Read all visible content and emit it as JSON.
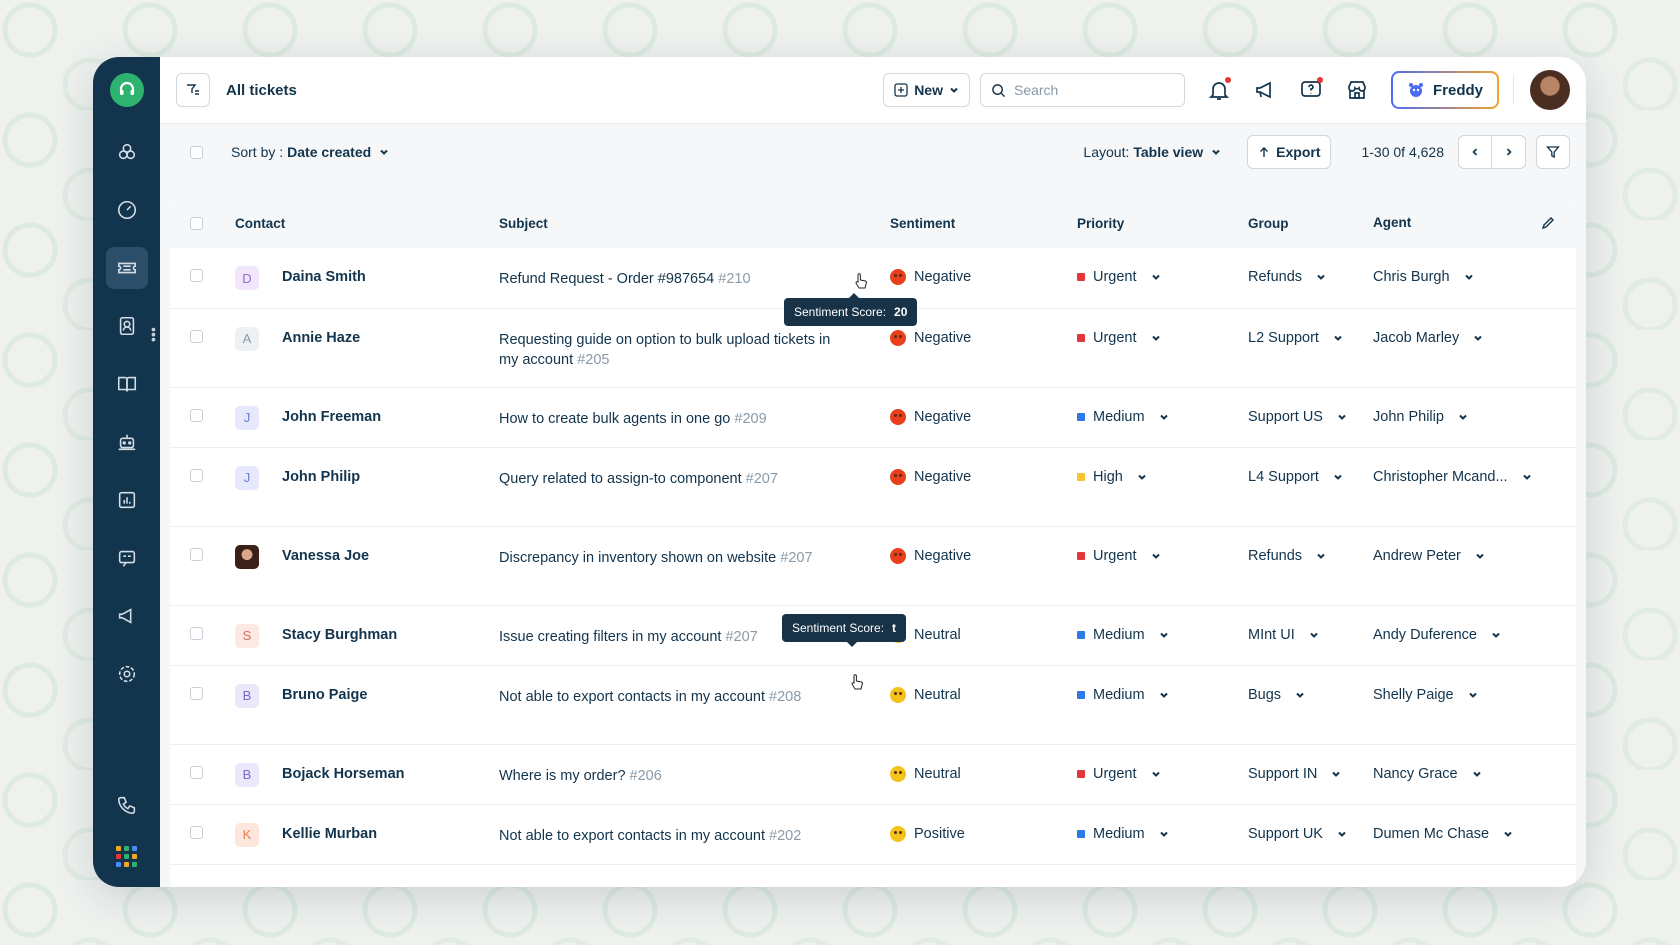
{
  "topbar": {
    "title": "All tickets",
    "new_label": "New",
    "search_placeholder": "Search",
    "freddy_label": "Freddy"
  },
  "toolbar": {
    "sort_prefix": "Sort by :",
    "sort_value": "Date created",
    "layout_prefix": "Layout:",
    "layout_value": "Table view",
    "export_label": "Export",
    "pager_text": "1-30 0f 4,628"
  },
  "table": {
    "headers": {
      "contact": "Contact",
      "subject": "Subject",
      "sentiment": "Sentiment",
      "priority": "Priority",
      "group": "Group",
      "agent": "Agent"
    },
    "rows": [
      {
        "initial": "D",
        "contact": "Daina Smith",
        "subject": "Refund Request - Order #987654",
        "id": "#210",
        "sentiment": "Negative",
        "priority": "Urgent",
        "group": "Refunds",
        "agent": "Chris Burgh"
      },
      {
        "initial": "A",
        "contact": "Annie Haze",
        "subject": "Requesting guide on option to bulk upload tickets in my account",
        "id": "#205",
        "sentiment": "Negative",
        "priority": "Urgent",
        "group": "L2 Support",
        "agent": "Jacob Marley"
      },
      {
        "initial": "J",
        "contact": "John Freeman",
        "subject": "How to create bulk agents in one go",
        "id": "#209",
        "sentiment": "Negative",
        "priority": "Medium",
        "group": "Support US",
        "agent": "John Philip"
      },
      {
        "initial": "J",
        "contact": "John Philip",
        "subject": "Query related to assign-to component",
        "id": "#207",
        "sentiment": "Negative",
        "priority": "High",
        "group": "L4 Support",
        "agent": "Christopher Mcand..."
      },
      {
        "initial": "",
        "contact": "Vanessa Joe",
        "subject": "Discrepancy in inventory shown on website",
        "id": "#207",
        "sentiment": "Negative",
        "priority": "Urgent",
        "group": "Refunds",
        "agent": "Andrew Peter"
      },
      {
        "initial": "S",
        "contact": "Stacy Burghman",
        "subject": "Issue creating filters in my account",
        "id": "#207",
        "sentiment": "Neutral",
        "priority": "Medium",
        "group": "MInt UI",
        "agent": "Andy Duference"
      },
      {
        "initial": "B",
        "contact": "Bruno Paige",
        "subject": "Not able to export contacts in my account",
        "id": "#208",
        "sentiment": "Neutral",
        "priority": "Medium",
        "group": "Bugs",
        "agent": "Shelly Paige"
      },
      {
        "initial": "B",
        "contact": "Bojack Horseman",
        "subject": "Where is my order?",
        "id": "#206",
        "sentiment": "Neutral",
        "priority": "Urgent",
        "group": "Support IN",
        "agent": "Nancy Grace"
      },
      {
        "initial": "K",
        "contact": "Kellie Murban",
        "subject": "Not able to export contacts in my account",
        "id": "#202",
        "sentiment": "Positive",
        "priority": "Medium",
        "group": "Support UK",
        "agent": "Dumen Mc Chase"
      }
    ]
  },
  "tooltips": [
    {
      "label": "Sentiment Score:",
      "value": "20"
    },
    {
      "label": "Sentiment Score:",
      "value": "t"
    }
  ],
  "colors": {
    "sidebar": "#12344d",
    "brand_green": "#2db36f",
    "urgent": "#e43538",
    "medium": "#2c7be5",
    "high": "#f7c62f"
  }
}
